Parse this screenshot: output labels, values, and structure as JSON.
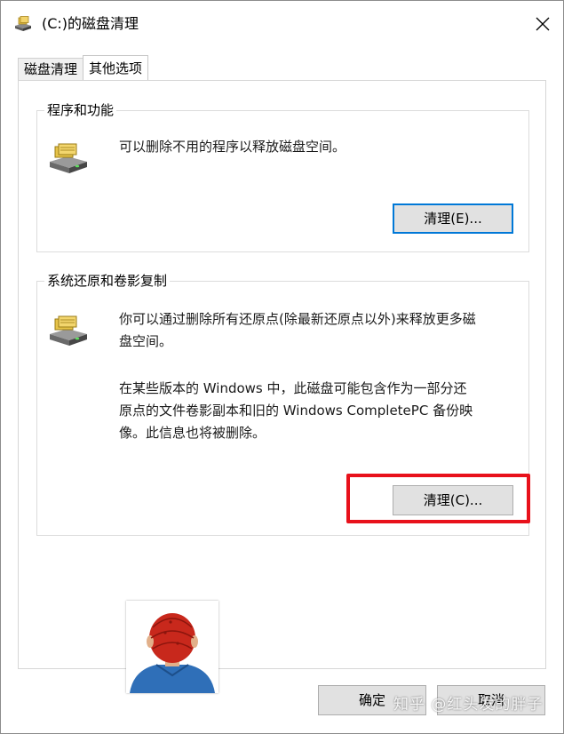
{
  "window": {
    "title": "(C:)的磁盘清理"
  },
  "tabs": [
    {
      "label": "磁盘清理",
      "active": false
    },
    {
      "label": "其他选项",
      "active": true
    }
  ],
  "programs_group": {
    "title": "程序和功能",
    "description": "可以删除不用的程序以释放磁盘空间。",
    "button_label": "清理(E)..."
  },
  "restore_group": {
    "title": "系统还原和卷影复制",
    "description_line1": "你可以通过删除所有还原点(除最新还原点以外)来释放更多磁",
    "description_line2": "盘空间。",
    "note_line1": "在某些版本的 Windows 中，此磁盘可能包含作为一部分还",
    "note_line2": "原点的文件卷影副本和旧的 Windows CompletePC 备份映",
    "note_line3": "像。此信息也将被删除。",
    "button_label": "清理(C)..."
  },
  "footer": {
    "ok_label": "确定",
    "cancel_label": "取消"
  },
  "watermark": "知乎 @红头发的胖子",
  "colors": {
    "highlight": "#e8111b",
    "focus": "#0078d7",
    "button_bg": "#e1e1e1"
  }
}
